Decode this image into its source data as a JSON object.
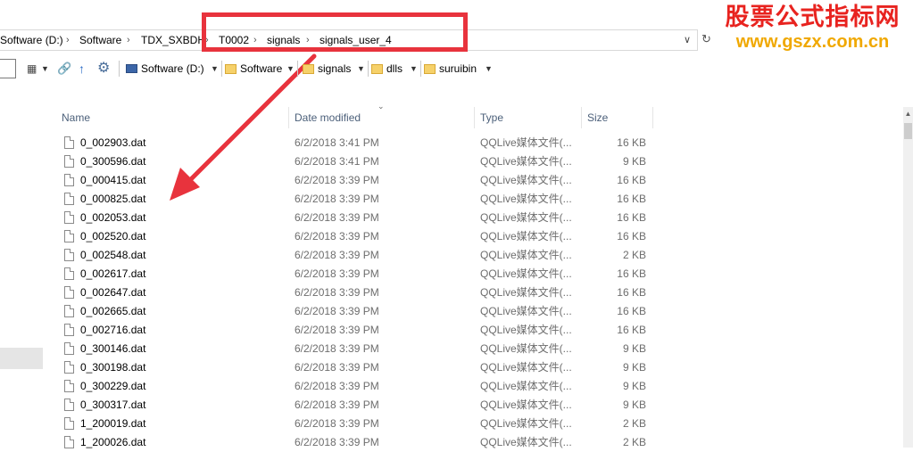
{
  "address_bar": {
    "crumbs": [
      "Software (D:)",
      "Software",
      "TDX_SXBDH",
      "T0002",
      "signals",
      "signals_user_4"
    ]
  },
  "toolbar": {
    "drive_label": "Software (D:)",
    "folders": [
      "Software",
      "signals",
      "dlls",
      "suruibin"
    ]
  },
  "columns": {
    "name": "Name",
    "date": "Date modified",
    "type": "Type",
    "size": "Size"
  },
  "files": [
    {
      "name": "0_002903.dat",
      "date": "6/2/2018 3:41 PM",
      "type": "QQLive媒体文件(...",
      "size": "16 KB"
    },
    {
      "name": "0_300596.dat",
      "date": "6/2/2018 3:41 PM",
      "type": "QQLive媒体文件(...",
      "size": "9 KB"
    },
    {
      "name": "0_000415.dat",
      "date": "6/2/2018 3:39 PM",
      "type": "QQLive媒体文件(...",
      "size": "16 KB"
    },
    {
      "name": "0_000825.dat",
      "date": "6/2/2018 3:39 PM",
      "type": "QQLive媒体文件(...",
      "size": "16 KB"
    },
    {
      "name": "0_002053.dat",
      "date": "6/2/2018 3:39 PM",
      "type": "QQLive媒体文件(...",
      "size": "16 KB"
    },
    {
      "name": "0_002520.dat",
      "date": "6/2/2018 3:39 PM",
      "type": "QQLive媒体文件(...",
      "size": "16 KB"
    },
    {
      "name": "0_002548.dat",
      "date": "6/2/2018 3:39 PM",
      "type": "QQLive媒体文件(...",
      "size": "2 KB"
    },
    {
      "name": "0_002617.dat",
      "date": "6/2/2018 3:39 PM",
      "type": "QQLive媒体文件(...",
      "size": "16 KB"
    },
    {
      "name": "0_002647.dat",
      "date": "6/2/2018 3:39 PM",
      "type": "QQLive媒体文件(...",
      "size": "16 KB"
    },
    {
      "name": "0_002665.dat",
      "date": "6/2/2018 3:39 PM",
      "type": "QQLive媒体文件(...",
      "size": "16 KB"
    },
    {
      "name": "0_002716.dat",
      "date": "6/2/2018 3:39 PM",
      "type": "QQLive媒体文件(...",
      "size": "16 KB"
    },
    {
      "name": "0_300146.dat",
      "date": "6/2/2018 3:39 PM",
      "type": "QQLive媒体文件(...",
      "size": "9 KB"
    },
    {
      "name": "0_300198.dat",
      "date": "6/2/2018 3:39 PM",
      "type": "QQLive媒体文件(...",
      "size": "9 KB"
    },
    {
      "name": "0_300229.dat",
      "date": "6/2/2018 3:39 PM",
      "type": "QQLive媒体文件(...",
      "size": "9 KB"
    },
    {
      "name": "0_300317.dat",
      "date": "6/2/2018 3:39 PM",
      "type": "QQLive媒体文件(...",
      "size": "9 KB"
    },
    {
      "name": "1_200019.dat",
      "date": "6/2/2018 3:39 PM",
      "type": "QQLive媒体文件(...",
      "size": "2 KB"
    },
    {
      "name": "1_200026.dat",
      "date": "6/2/2018 3:39 PM",
      "type": "QQLive媒体文件(...",
      "size": "2 KB"
    }
  ],
  "watermark": {
    "line1": "股票公式指标网",
    "line2": "www.gszx.com.cn"
  },
  "colors": {
    "annotation_red": "#e8333d",
    "watermark_red": "#e8231f",
    "watermark_orange": "#f0a800",
    "header_text": "#4c607a"
  },
  "icons": {
    "refresh": "refresh-icon",
    "up": "up-arrow-icon",
    "settings": "gear-icon",
    "file": "file-icon",
    "folder": "folder-icon"
  }
}
